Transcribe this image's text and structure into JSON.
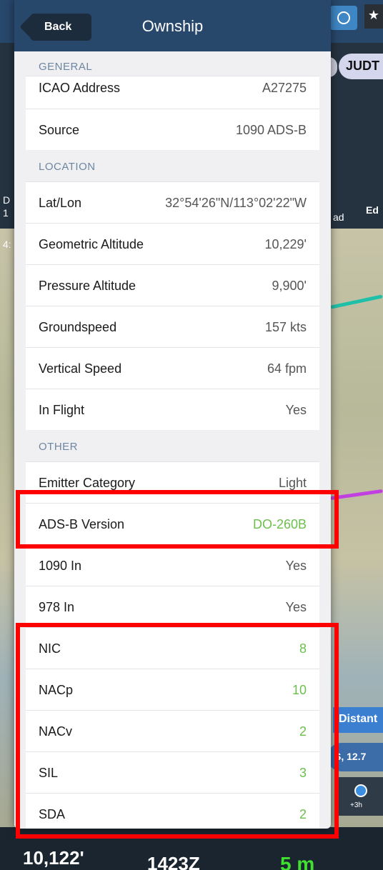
{
  "background": {
    "chip_label": "JUDT",
    "side_text": [
      "D",
      "1",
      "4:",
      "ad",
      "Ed"
    ],
    "distance_label": "Distant",
    "alt_pill": "S, 12.7",
    "timeline_label": "+3h",
    "bottom": {
      "altitude_caption": "",
      "altitude": "10,122'",
      "time": "1423Z",
      "eta": "5 m"
    }
  },
  "header": {
    "back_label": "Back",
    "title": "Ownship"
  },
  "sections": {
    "general": "GENERAL",
    "location": "LOCATION",
    "other": "OTHER"
  },
  "rows": {
    "icao": {
      "label": "ICAO Address",
      "value": "A27275"
    },
    "source": {
      "label": "Source",
      "value": "1090 ADS-B"
    },
    "latlon": {
      "label": "Lat/Lon",
      "value": "32°54'26\"N/113°02'22\"W"
    },
    "geo_alt": {
      "label": "Geometric Altitude",
      "value": "10,229'"
    },
    "press_alt": {
      "label": "Pressure Altitude",
      "value": "9,900'"
    },
    "groundspeed": {
      "label": "Groundspeed",
      "value": "157 kts"
    },
    "vspeed": {
      "label": "Vertical Speed",
      "value": "64 fpm"
    },
    "in_flight": {
      "label": "In Flight",
      "value": "Yes"
    },
    "emitter": {
      "label": "Emitter Category",
      "value": "Light"
    },
    "adsb_version": {
      "label": "ADS-B Version",
      "value": "DO-260B"
    },
    "in_1090": {
      "label": "1090 In",
      "value": "Yes"
    },
    "in_978": {
      "label": "978 In",
      "value": "Yes"
    },
    "nic": {
      "label": "NIC",
      "value": "8"
    },
    "nacp": {
      "label": "NACp",
      "value": "10"
    },
    "nacv": {
      "label": "NACv",
      "value": "2"
    },
    "sil": {
      "label": "SIL",
      "value": "3"
    },
    "sda": {
      "label": "SDA",
      "value": "2"
    }
  },
  "colors": {
    "header_blue": "#27476b",
    "section_text": "#6e86a0",
    "green_value": "#6cbf4d",
    "highlight_red": "#ff0000"
  }
}
